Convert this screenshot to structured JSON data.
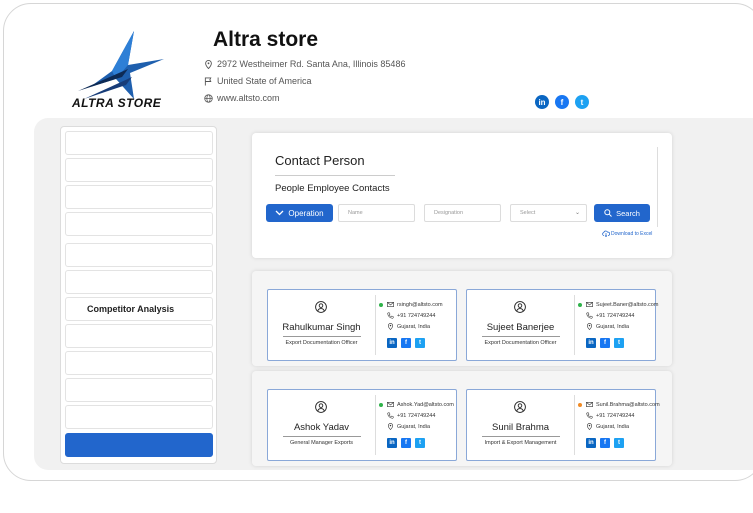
{
  "brand": {
    "logo_text": "ALTRA STORE",
    "store_name": "Altra store",
    "address": "2972 Westheimer Rd. Santa Ana, Illinois 85486",
    "country": "United State of America",
    "website": "www.altsto.com",
    "socials": [
      {
        "icon": "linkedin-icon",
        "label": "in",
        "color": "#0a66c2"
      },
      {
        "icon": "facebook-icon",
        "label": "f",
        "color": "#1877f2"
      },
      {
        "icon": "twitter-icon",
        "label": "t",
        "color": "#1da1f2"
      }
    ]
  },
  "sidebar": {
    "items": [
      {
        "label": "",
        "active": false
      },
      {
        "label": "",
        "active": false
      },
      {
        "label": "",
        "active": false
      },
      {
        "label": "",
        "active": false
      },
      {
        "label": "",
        "active": false
      },
      {
        "label": "",
        "active": false
      },
      {
        "label": "Competitor Analysis",
        "active": false
      },
      {
        "label": "",
        "active": false
      },
      {
        "label": "",
        "active": false
      },
      {
        "label": "",
        "active": false
      },
      {
        "label": "",
        "active": false
      },
      {
        "label": "",
        "active": true
      }
    ]
  },
  "contact_panel": {
    "title": "Contact Person",
    "subtitle": "People Employee Contacts",
    "operation_label": "Operation",
    "name_placeholder": "Name",
    "designation_placeholder": "Designation",
    "select_placeholder": "Select",
    "search_label": "Search",
    "download_label": "Download to Excel"
  },
  "contacts": [
    {
      "name": "Rahulkumar Singh",
      "role": "Export Documentation Officer",
      "email": "rsingh@altsto.com",
      "phone": "+91 724749244",
      "location": "Gujarat, India",
      "status_color": "#2fb24a"
    },
    {
      "name": "Sujeet Banerjee",
      "role": "Export Documentation Officer",
      "email": "Sujeet.Baner@altsto.com",
      "phone": "+91 724749244",
      "location": "Gujarat, India",
      "status_color": "#2fb24a"
    },
    {
      "name": "Ashok Yadav",
      "role": "General Manager Exports",
      "email": "Ashok.Yad@altsto.com",
      "phone": "+91 724749244",
      "location": "Gujarat, India",
      "status_color": "#2fb24a"
    },
    {
      "name": "Sunil Brahma",
      "role": "Import & Export Management",
      "email": "Sunil.Brahma@altsto.com",
      "phone": "+91 724749244",
      "location": "Gujarat, India",
      "status_color": "#f08a24"
    }
  ],
  "colors": {
    "accent": "#2266cc"
  }
}
